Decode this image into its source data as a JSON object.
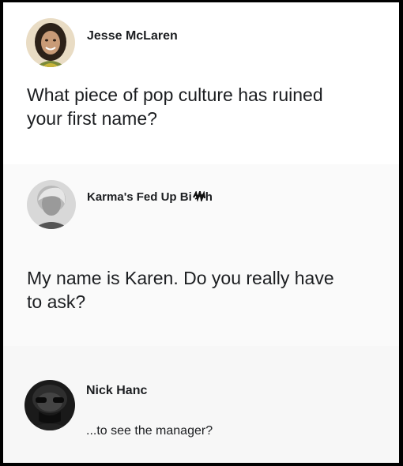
{
  "posts": [
    {
      "author": "Jesse McLaren",
      "text_line1": "What piece of pop culture has ruined",
      "text_line2": "your first name?",
      "avatar_icon": "profile-photo-woman-smiling"
    },
    {
      "author_visible": "Karma's Fed Up Bi",
      "author_tail": "h",
      "text_line1": "My name is Karen. Do you really have",
      "text_line2": "to ask?",
      "avatar_icon": "profile-photo-woman-grayscale",
      "obscured_icon": "scribble-icon"
    },
    {
      "author": "Nick Hanc",
      "text": "...to see the manager?",
      "avatar_icon": "profile-photo-masked-man"
    }
  ],
  "colors": {
    "background": "#000000",
    "card": "#ffffff",
    "text": "#1c1e21"
  }
}
